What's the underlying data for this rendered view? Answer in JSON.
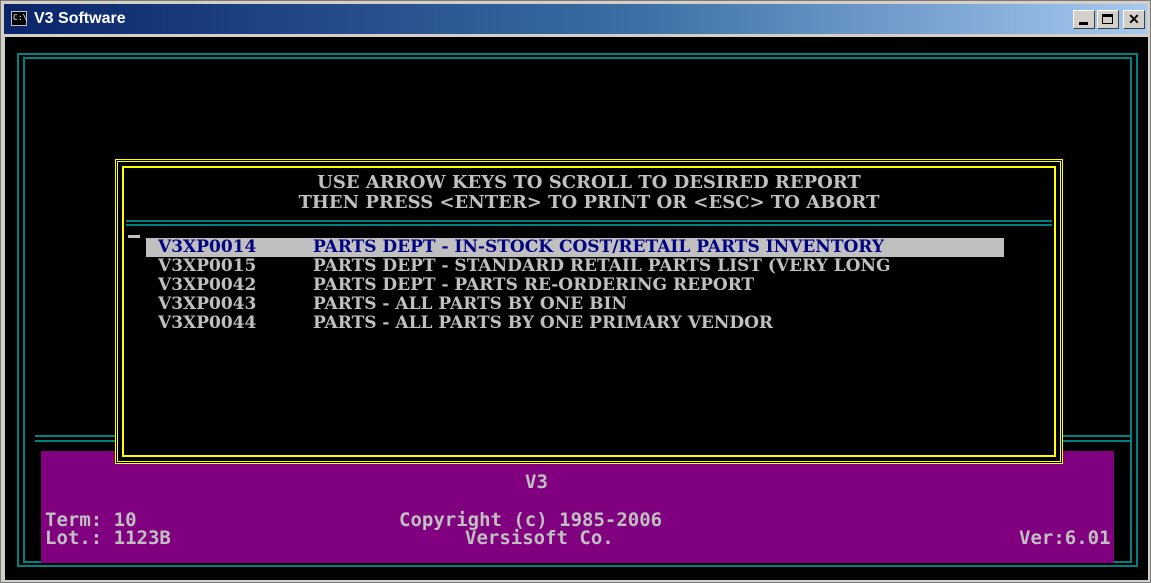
{
  "window": {
    "title": "V3 Software",
    "controls": {
      "minimize": "_",
      "maximize": "□",
      "close": "✕"
    }
  },
  "dialog": {
    "instruction_line1": "USE ARROW KEYS TO SCROLL TO DESIRED REPORT",
    "instruction_line2": "THEN PRESS <ENTER> TO PRINT OR <ESC> TO ABORT",
    "cursor": "_",
    "reports": [
      {
        "code": "V3XP0014",
        "description": "PARTS DEPT - IN-STOCK COST/RETAIL PARTS INVENTORY",
        "selected": true
      },
      {
        "code": "V3XP0015",
        "description": "PARTS DEPT - STANDARD RETAIL PARTS LIST (VERY LONG",
        "selected": false
      },
      {
        "code": "V3XP0042",
        "description": "PARTS DEPT - PARTS RE-ORDERING REPORT",
        "selected": false
      },
      {
        "code": "V3XP0043",
        "description": "PARTS - ALL PARTS BY ONE BIN",
        "selected": false
      },
      {
        "code": "V3XP0044",
        "description": "PARTS - ALL PARTS BY ONE PRIMARY VENDOR",
        "selected": false
      }
    ]
  },
  "footer": {
    "system_name": "V3",
    "term": "Term: 10",
    "lot": "Lot.: 1123B",
    "copyright": "Copyright (c) 1985-2006",
    "company": "Versisoft Co.",
    "version": "Ver:6.01"
  },
  "colors": {
    "console_bg": "#000000",
    "console_text": "#c0c0c0",
    "dialog_border": "#ffff00",
    "frame_line": "#008080",
    "footer_bg": "#800080",
    "selection_bg": "#c0c0c0",
    "selection_text": "#000080"
  }
}
